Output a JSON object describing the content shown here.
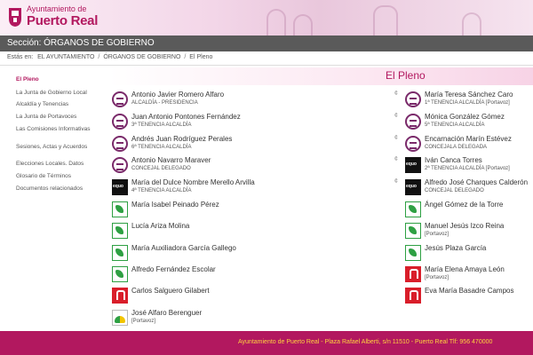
{
  "header": {
    "logo_line1": "Ayuntamiento de",
    "logo_line2": "Puerto Real"
  },
  "section": {
    "title": "Sección: ÓRGANOS DE GOBIERNO"
  },
  "breadcrumb": {
    "prefix": "Estás en:",
    "items": [
      "EL AYUNTAMIENTO",
      "ÓRGANOS DE GOBIERNO",
      "El Pleno"
    ],
    "separator": "/"
  },
  "sidebar": {
    "items": [
      {
        "label": "El Pleno",
        "active": true
      },
      {
        "label": "La Junta de Gobierno Local"
      },
      {
        "label": "Alcaldía y Tenencias"
      },
      {
        "label": "La Junta de Portavoces"
      },
      {
        "label": "Las Comisiones Informativas"
      },
      {
        "label": "Sesiones, Actas y Acuerdos"
      },
      {
        "label": "Elecciones Locales. Datos"
      },
      {
        "label": "Glosario de Términos"
      },
      {
        "label": "Documentos relacionados"
      }
    ]
  },
  "main": {
    "title": "El Pleno",
    "members_left": [
      {
        "name": "Antonio Javier Romero Alfaro",
        "role": "ALCALDÍA - PRESIDENCIA",
        "party_icon": "pp-logo"
      },
      {
        "name": "Juan Antonio Pontones Fernández",
        "role": "3ª TENENCIA ALCALDÍA",
        "party_icon": "pp-logo"
      },
      {
        "name": "Andrés Juan Rodríguez Perales",
        "role": "6ª TENENCIA ALCALDÍA",
        "party_icon": "pp-logo"
      },
      {
        "name": "Antonio Navarro Maraver",
        "role": "CONCEJAL DELEGADO",
        "party_icon": "pp-logo"
      },
      {
        "name": "María del Dulce Nombre Merello Arvilla",
        "role": "4ª TENENCIA ALCALDÍA",
        "party_icon": "equo-logo"
      },
      {
        "name": "María Isabel Peinado Pérez",
        "role": "",
        "party_icon": "green-logo"
      },
      {
        "name": "Lucía Ariza Molina",
        "role": "",
        "party_icon": "green-logo"
      },
      {
        "name": "María Auxiliadora García Gallego",
        "role": "",
        "party_icon": "green-logo"
      },
      {
        "name": "Alfredo Fernández Escolar",
        "role": "",
        "party_icon": "green-logo"
      },
      {
        "name": "Carlos Salguero Gilabert",
        "role": "",
        "party_icon": "psoe-logo"
      },
      {
        "name": "José Alfaro Berenguer",
        "role": "[Portavoz]",
        "party_icon": "ip-logo"
      }
    ],
    "members_right": [
      {
        "name": "María Teresa Sánchez Caro",
        "role": "1ª TENENCIA ALCALDÍA [Portavoz]",
        "party_icon": "pp-logo"
      },
      {
        "name": "Mónica González Gómez",
        "role": "5ª TENENCIA ALCALDÍA",
        "party_icon": "pp-logo"
      },
      {
        "name": "Encarnación Marín Estévez",
        "role": "CONCEJALA DELEGADA",
        "party_icon": "pp-logo"
      },
      {
        "name": "Iván Canca Torres",
        "role": "2ª TENENCIA ALCALDÍA [Portavoz]",
        "party_icon": "equo-logo"
      },
      {
        "name": "Alfredo José Charques Calderón",
        "role": "CONCEJAL DELEGADO",
        "party_icon": "equo-logo"
      },
      {
        "name": "Ángel Gómez de la Torre",
        "role": "",
        "party_icon": "green-logo"
      },
      {
        "name": "Manuel Jesús Izco Reina",
        "role": "[Portavoz]",
        "party_icon": "green-logo"
      },
      {
        "name": "Jesús Plaza García",
        "role": "",
        "party_icon": "green-logo"
      },
      {
        "name": "María Elena Amaya León",
        "role": "[Portavoz]",
        "party_icon": "psoe-logo"
      },
      {
        "name": "Eva María Basadre Campos",
        "role": "",
        "party_icon": "psoe-logo"
      }
    ],
    "marker": "¢",
    "equo_text": "equo"
  },
  "footer": {
    "text": "Ayuntamiento de Puerto Real - Plaza Rafael Alberti, s/n 11510 - Puerto Real Tlf: 956 470000"
  },
  "colors": {
    "brand": "#b2185f",
    "footer_text": "#ffd23f",
    "section_bar": "#5a5a5a"
  }
}
